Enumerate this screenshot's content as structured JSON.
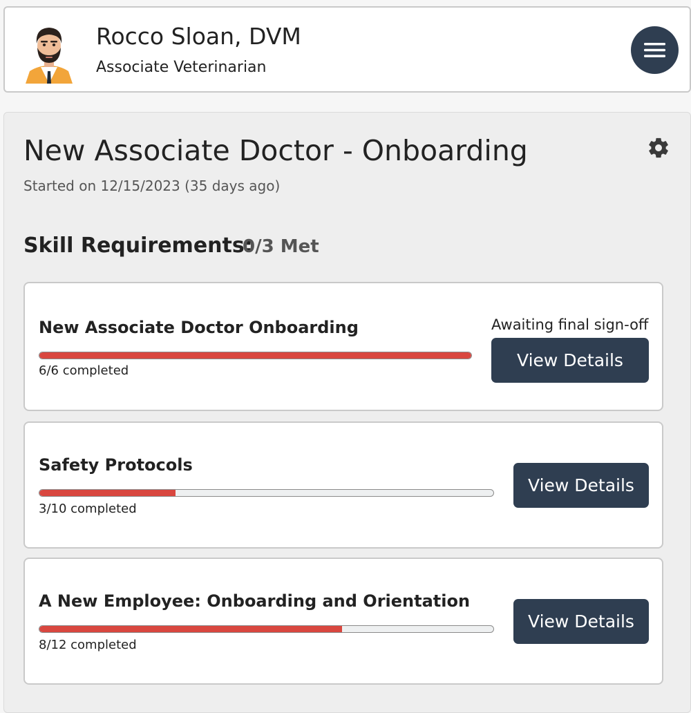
{
  "profile": {
    "name": "Rocco Sloan, DVM",
    "role": "Associate Veterinarian"
  },
  "onboarding": {
    "title": "New Associate Doctor - Onboarding",
    "started": "Started on 12/15/2023 (35 days ago)",
    "skills_heading": "Skill Requirements:",
    "skills_met": "0/3 Met"
  },
  "skills": [
    {
      "name": "New Associate Doctor Onboarding",
      "progress_label": "6/6 completed",
      "progress_fraction": 1.0,
      "status": "Awaiting final sign-off",
      "button_label": "View Details"
    },
    {
      "name": "Safety Protocols",
      "progress_label": "3/10 completed",
      "progress_fraction": 0.3,
      "status": "",
      "button_label": "View Details"
    },
    {
      "name": "A New Employee: Onboarding and Orientation",
      "progress_label": "8/12 completed",
      "progress_fraction": 0.6667,
      "status": "",
      "button_label": "View Details"
    }
  ],
  "icons": {
    "menu": "hamburger-menu-icon",
    "settings": "gear-icon",
    "avatar": "avatar"
  },
  "colors": {
    "accent_dark": "#2f3e51",
    "progress_fill": "#d9473f",
    "progress_track": "#eef0f1"
  }
}
